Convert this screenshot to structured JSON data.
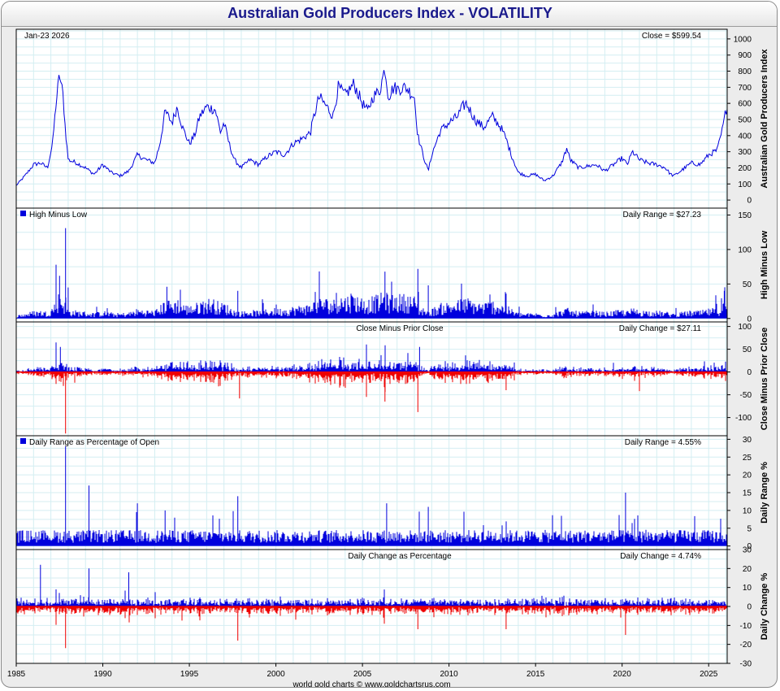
{
  "title": "Australian Gold Producers Index - VOLATILITY",
  "footer": "world gold charts © www.goldchartsrus.com",
  "colors": {
    "title": "#1a1a8c",
    "up": "#0000dd",
    "down": "#ee0000",
    "grid": "#d4eef2",
    "frame": "#000000"
  },
  "chart_data": {
    "type": "line",
    "x_axis": {
      "range": [
        1985,
        2026.07
      ],
      "ticks": [
        "1985",
        "1990",
        "1995",
        "2000",
        "2005",
        "2010",
        "2015",
        "2020",
        "2025"
      ]
    },
    "panels": [
      {
        "key": "close",
        "type": "line",
        "ylabel": "Australian Gold Producers Index",
        "left_label": "Jan-23  2026",
        "right_label": "Close = $599.54",
        "ylim": [
          -50,
          1060
        ],
        "yticks": [
          0,
          100,
          200,
          300,
          400,
          500,
          600,
          700,
          800,
          900,
          1000
        ],
        "x": [
          1985.0,
          1985.5,
          1986.0,
          1986.4,
          1986.8,
          1987.1,
          1987.3,
          1987.5,
          1987.7,
          1987.85,
          1988.0,
          1988.5,
          1989.0,
          1989.5,
          1990.0,
          1990.5,
          1991.0,
          1991.5,
          1992.0,
          1992.5,
          1993.0,
          1993.3,
          1993.6,
          1994.0,
          1994.3,
          1994.6,
          1995.0,
          1995.3,
          1995.6,
          1996.0,
          1996.5,
          1996.8,
          1997.0,
          1997.3,
          1997.6,
          1998.0,
          1998.5,
          1999.0,
          1999.5,
          2000.0,
          2000.5,
          2001.0,
          2001.5,
          2002.0,
          2002.2,
          2002.5,
          2003.0,
          2003.3,
          2003.6,
          2004.0,
          2004.5,
          2005.0,
          2005.3,
          2005.6,
          2006.0,
          2006.3,
          2006.5,
          2006.8,
          2007.0,
          2007.5,
          2008.0,
          2008.2,
          2008.5,
          2008.8,
          2009.0,
          2009.5,
          2010.0,
          2010.5,
          2010.8,
          2011.0,
          2011.5,
          2012.0,
          2012.5,
          2013.0,
          2013.3,
          2013.6,
          2014.0,
          2014.5,
          2015.0,
          2015.5,
          2016.0,
          2016.5,
          2016.8,
          2017.0,
          2017.5,
          2018.0,
          2018.5,
          2019.0,
          2019.5,
          2020.0,
          2020.3,
          2020.6,
          2021.0,
          2021.5,
          2022.0,
          2022.5,
          2022.8,
          2023.0,
          2023.5,
          2024.0,
          2024.5,
          2025.0,
          2025.5,
          2025.8,
          2026.07
        ],
        "values": [
          90,
          150,
          220,
          230,
          200,
          350,
          600,
          780,
          650,
          420,
          250,
          230,
          200,
          160,
          220,
          170,
          150,
          180,
          280,
          250,
          230,
          350,
          550,
          480,
          580,
          450,
          350,
          400,
          520,
          580,
          560,
          420,
          480,
          350,
          250,
          200,
          250,
          220,
          270,
          300,
          280,
          350,
          380,
          420,
          520,
          640,
          570,
          520,
          700,
          650,
          720,
          600,
          550,
          640,
          680,
          820,
          640,
          700,
          690,
          700,
          640,
          400,
          280,
          180,
          280,
          430,
          480,
          520,
          580,
          600,
          500,
          450,
          520,
          450,
          380,
          280,
          170,
          150,
          160,
          120,
          150,
          230,
          320,
          250,
          200,
          210,
          220,
          180,
          220,
          260,
          220,
          300,
          250,
          230,
          220,
          200,
          160,
          150,
          190,
          230,
          220,
          280,
          310,
          440,
          600
        ]
      },
      {
        "key": "high_minus_low",
        "type": "bar",
        "ylabel": "High Minus Low",
        "left_label": "High Minus Low",
        "right_label": "Daily Range = $27.23",
        "ylim": [
          -5,
          160
        ],
        "yticks": [
          0,
          50,
          100,
          150
        ],
        "spikes": [
          [
            1987.85,
            131
          ],
          [
            1987.3,
            78
          ],
          [
            1987.5,
            62
          ],
          [
            1988.0,
            45
          ],
          [
            1993.7,
            46
          ],
          [
            2006.3,
            68
          ],
          [
            2008.2,
            72
          ],
          [
            2008.8,
            48
          ],
          [
            1997.8,
            40
          ],
          [
            2025.9,
            40
          ],
          [
            2013.3,
            36
          ]
        ],
        "current": 27.23
      },
      {
        "key": "close_minus_prior",
        "type": "bar",
        "ylabel": "Close Minus Prior Close",
        "center_label": "Close Minus Prior Close",
        "right_label": "Daily Change = $27.11",
        "ylim": [
          -140,
          110
        ],
        "yticks": [
          -100,
          -50,
          0,
          50,
          100
        ],
        "spikes": [
          [
            1987.85,
            -135
          ],
          [
            1987.3,
            65
          ],
          [
            1987.55,
            55
          ],
          [
            2008.2,
            -88
          ],
          [
            2008.3,
            55
          ],
          [
            1997.9,
            -58
          ],
          [
            2006.3,
            -65
          ],
          [
            2013.3,
            -40
          ],
          [
            2021.0,
            -42
          ]
        ],
        "current": 27.11
      },
      {
        "key": "range_pct",
        "type": "bar",
        "ylabel": "Daily Range %",
        "left_label": "Daily Range as Percentage of Open",
        "right_label": "Daily Range = 4.55%",
        "ylim": [
          -1,
          31
        ],
        "yticks": [
          0,
          5,
          10,
          15,
          20,
          25,
          30
        ],
        "spikes": [
          [
            1987.85,
            28
          ],
          [
            1989.2,
            17
          ],
          [
            1997.8,
            14
          ],
          [
            2020.2,
            15
          ],
          [
            1993.6,
            10
          ],
          [
            2008.8,
            11
          ],
          [
            2006.4,
            12
          ],
          [
            1992.0,
            12
          ]
        ],
        "current": 4.55
      },
      {
        "key": "change_pct",
        "type": "bar",
        "ylabel": "Daily Change %",
        "center_label": "Daily Change as Percentage",
        "right_label": "Daily Change = 4.74%",
        "ylim": [
          -30,
          30
        ],
        "yticks": [
          -30,
          -20,
          -10,
          0,
          10,
          20,
          30
        ],
        "spikes": [
          [
            1987.85,
            -22
          ],
          [
            1986.4,
            22
          ],
          [
            1989.2,
            20
          ],
          [
            1991.5,
            18
          ],
          [
            1997.8,
            -18
          ],
          [
            2020.2,
            -15
          ],
          [
            2008.2,
            -12
          ],
          [
            2013.3,
            -12
          ]
        ],
        "current": 4.74
      }
    ]
  }
}
